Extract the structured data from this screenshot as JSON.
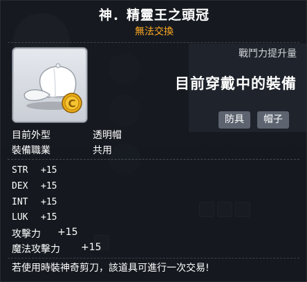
{
  "item": {
    "title": "神．精靈王之頭冠",
    "trade_status": "無法交換",
    "icon": "white-cap-with-gold-coin-icon"
  },
  "panel": {
    "power_label": "戰鬥力提升量",
    "equipped_text": "目前穿戴中的裝備",
    "tags": [
      "防具",
      "帽子"
    ]
  },
  "info": [
    {
      "key": "目前外型",
      "value": "透明帽"
    },
    {
      "key": "裝備職業",
      "value": "共用"
    }
  ],
  "stats": [
    {
      "name": "STR",
      "value": "+15"
    },
    {
      "name": "DEX",
      "value": "+15"
    },
    {
      "name": "INT",
      "value": "+15"
    },
    {
      "name": "LUK",
      "value": "+15"
    },
    {
      "name": "攻擊力",
      "value": "+15"
    },
    {
      "name": "魔法攻擊力",
      "value": "+15"
    }
  ],
  "footer": "若使用時裝神奇剪刀，該道具可進行一次交易!",
  "colors": {
    "title": "#ffffff",
    "trade_status": "#ffaa22",
    "tag_bg": "#5d6470",
    "tooltip_bg": "#12161c"
  }
}
